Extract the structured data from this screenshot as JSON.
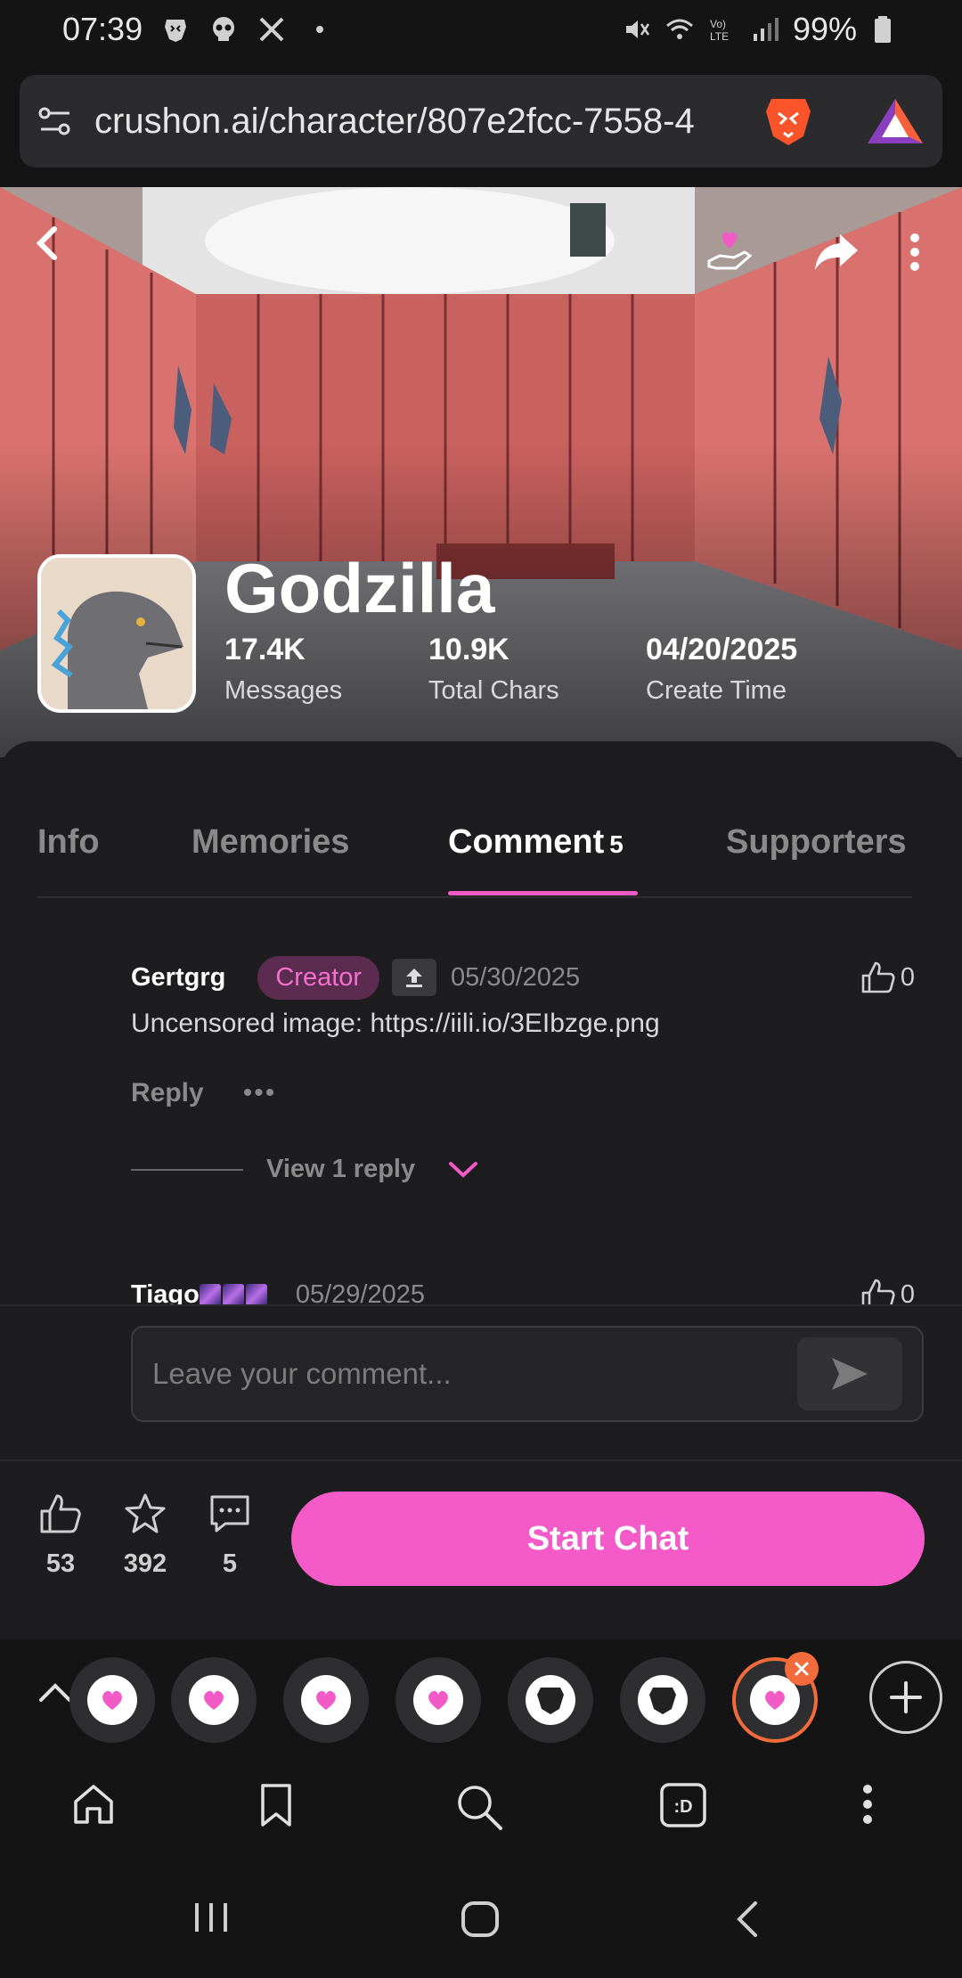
{
  "status_bar": {
    "time": "07:39",
    "battery": "99%"
  },
  "browser": {
    "url": "crushon.ai/character/807e2fcc-7558-4"
  },
  "character": {
    "name": "Godzilla",
    "stats": [
      {
        "value": "17.4K",
        "label": "Messages"
      },
      {
        "value": "10.9K",
        "label": "Total Chars"
      },
      {
        "value": "04/20/2025",
        "label": "Create Time"
      }
    ]
  },
  "tabs": [
    {
      "label": "Info"
    },
    {
      "label": "Memories"
    },
    {
      "label": "Comment",
      "count": "5",
      "active": true
    },
    {
      "label": "Supporters"
    }
  ],
  "comments": [
    {
      "user": "Gertgrg",
      "badge": "Creator",
      "date": "05/30/2025",
      "likes": "0",
      "text": "Uncensored image: https://iili.io/3EIbzge.png",
      "reply_label": "Reply",
      "more_label": "•••",
      "view_replies": "View 1 reply"
    },
    {
      "user": "Tiago",
      "date": "05/29/2025",
      "likes": "0"
    }
  ],
  "comment_input": {
    "placeholder": "Leave your comment..."
  },
  "actions": {
    "likes": "53",
    "favorites": "392",
    "comments": "5",
    "start_chat": "Start Chat"
  },
  "colors": {
    "accent": "#f45ac8",
    "background": "#1d1d1f",
    "badge_bg": "#5c2b50"
  }
}
